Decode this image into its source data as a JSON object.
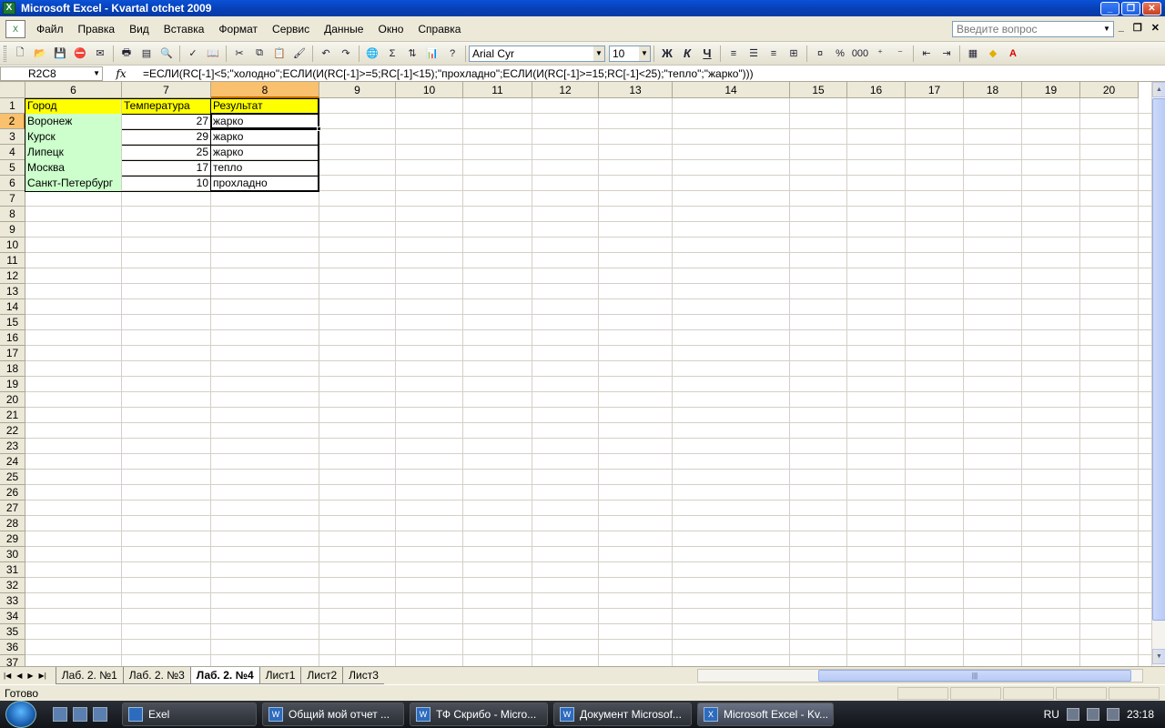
{
  "window": {
    "title": "Microsoft Excel - Kvartal otchet 2009"
  },
  "menu": {
    "items": [
      "Файл",
      "Правка",
      "Вид",
      "Вставка",
      "Формат",
      "Сервис",
      "Данные",
      "Окно",
      "Справка"
    ],
    "ask_placeholder": "Введите вопрос"
  },
  "toolbar": {
    "font_name": "Arial Cyr",
    "font_size": "10",
    "bold": "Ж",
    "italic": "К",
    "underline": "Ч",
    "percent": "%",
    "thousands": "000",
    "sum": "Σ"
  },
  "formula_bar": {
    "name_box": "R2C8",
    "fx": "fx",
    "formula": "=ЕСЛИ(RC[-1]<5;\"холодно\";ЕСЛИ(И(RC[-1]>=5;RC[-1]<15);\"прохладно\";ЕСЛИ(И(RC[-1]>=15;RC[-1]<25);\"тепло\";\"жарко\")))"
  },
  "sheet": {
    "columns": [
      "6",
      "7",
      "8",
      "9",
      "10",
      "11",
      "12",
      "13",
      "14",
      "15",
      "16",
      "17",
      "18",
      "19",
      "20"
    ],
    "active_column": "8",
    "rows": [
      "1",
      "2",
      "3",
      "4",
      "5",
      "6",
      "7",
      "8",
      "9",
      "10",
      "11",
      "12",
      "13",
      "14",
      "15",
      "16",
      "17",
      "18",
      "19",
      "20",
      "21",
      "22",
      "23",
      "24",
      "25",
      "26",
      "27",
      "28",
      "29",
      "30",
      "31",
      "32",
      "33",
      "34",
      "35",
      "36",
      "37"
    ],
    "active_row": "2",
    "header": {
      "city": "Город",
      "temp": "Температура",
      "result": "Результат"
    },
    "data": [
      {
        "city": "Воронеж",
        "temp": "27",
        "result": "жарко"
      },
      {
        "city": "Курск",
        "temp": "29",
        "result": "жарко"
      },
      {
        "city": "Липецк",
        "temp": "25",
        "result": "жарко"
      },
      {
        "city": "Москва",
        "temp": "17",
        "result": "тепло"
      },
      {
        "city": "Санкт-Петербург",
        "temp": "10",
        "result": "прохладно"
      }
    ],
    "colors": {
      "header_fill": "#ffff00",
      "city_fill": "#ccffcc",
      "active_header": "#f9c06d"
    }
  },
  "tabs": [
    "Лаб. 2. №1",
    "Лаб. 2. №3",
    "Лаб. 2. №4",
    "Лист1",
    "Лист2",
    "Лист3"
  ],
  "active_tab": "Лаб. 2. №4",
  "status": {
    "text": "Готово"
  },
  "taskbar": {
    "tasks": [
      "Exel",
      "Общий мой отчет ...",
      "ТФ Скрибо - Micro...",
      "Документ Microsof...",
      "Microsoft Excel - Kv..."
    ],
    "lang": "RU",
    "clock": "23:18"
  }
}
